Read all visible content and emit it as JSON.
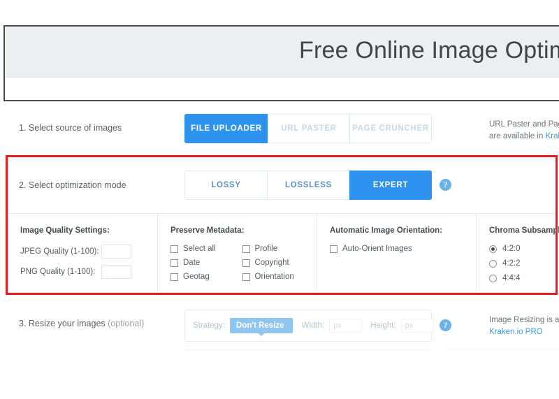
{
  "header": {
    "title": "Free Online Image Optim"
  },
  "sections": {
    "source": {
      "label": "1. Select source of images",
      "buttons": [
        {
          "label": "FILE UPLOADER",
          "state": "active"
        },
        {
          "label": "URL PASTER",
          "state": "inactive"
        },
        {
          "label": "PAGE CRUNCHER",
          "state": "inactive"
        }
      ],
      "note_line1": "URL Paster and Page",
      "note_line2_prefix": "are available in ",
      "note_line2_link": "Krake"
    },
    "mode": {
      "label": "2. Select optimization mode",
      "buttons": [
        {
          "label": "LOSSY",
          "state": "inactive"
        },
        {
          "label": "LOSSLESS",
          "state": "inactive"
        },
        {
          "label": "EXPERT",
          "state": "active"
        }
      ],
      "help_icon": "question-mark-icon",
      "help_glyph": "?"
    },
    "resize": {
      "label": "3. Resize your images",
      "optional": " (optional)",
      "strategy_label": "Strategy:",
      "strategy_value": "Don't Resize",
      "width_label": "Width:",
      "width_value": "",
      "width_placeholder": "px",
      "height_label": "Height:",
      "height_value": "",
      "height_placeholder": "px",
      "help_glyph": "?",
      "note_line1": "Image Resizing is ava",
      "note_line2_link": "Kraken.io PRO"
    }
  },
  "expert_settings": {
    "quality": {
      "title": "Image Quality Settings:",
      "fields": [
        {
          "label": "JPEG Quality (1-100):",
          "value": ""
        },
        {
          "label": "PNG Quality (1-100):",
          "value": ""
        }
      ]
    },
    "metadata": {
      "title": "Preserve Metadata:",
      "items": [
        {
          "label": "Select all",
          "checked": false
        },
        {
          "label": "Profile",
          "checked": false
        },
        {
          "label": "Date",
          "checked": false
        },
        {
          "label": "Copyright",
          "checked": false
        },
        {
          "label": "Geotag",
          "checked": false
        },
        {
          "label": "Orientation",
          "checked": false
        }
      ]
    },
    "orientation": {
      "title": "Automatic Image Orientation:",
      "items": [
        {
          "label": "Auto-Orient Images",
          "checked": false
        }
      ]
    },
    "chroma": {
      "title": "Chroma Subsampling:",
      "options": [
        {
          "label": "4:2:0",
          "selected": true
        },
        {
          "label": "4:2:2",
          "selected": false
        },
        {
          "label": "4:4:4",
          "selected": false
        }
      ]
    }
  },
  "colors": {
    "accent_blue": "#2e93ee",
    "link_blue": "#3d9ae8",
    "highlight_red": "#e01f1f",
    "header_gray": "#eceff0"
  }
}
